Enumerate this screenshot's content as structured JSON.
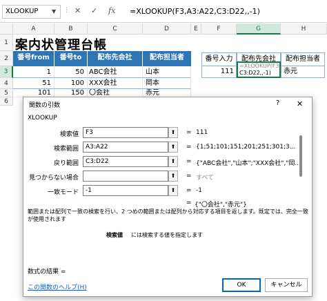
{
  "formula_bar": {
    "name_box": "XLOOKUP",
    "cancel_icon": "✕",
    "enter_icon": "✓",
    "fx_icon": "fx",
    "formula": "=XLOOKUP(F3,A3:A22,C3:D22,,-1)"
  },
  "columns": [
    "A",
    "B",
    "C",
    "D",
    "E",
    "F",
    "G",
    "H"
  ],
  "rows": [
    "1",
    "2",
    "3",
    "4",
    "5",
    "6"
  ],
  "sheet": {
    "title": "案内状管理台帳",
    "headers": [
      "番号from",
      "番号to",
      "配布先会社",
      "配布担当者"
    ],
    "data": [
      [
        "1",
        "50",
        "ABC会社",
        "山本"
      ],
      [
        "51",
        "100",
        "XXX会社",
        "岡本"
      ],
      [
        "101",
        "150",
        "〇会社",
        "赤元"
      ]
    ],
    "lookup_headers": [
      "番号入力",
      "配布先会社",
      "配布担当者"
    ],
    "lookup_input": "111",
    "editing_formula": "C3:D22,,-1)",
    "editing_formula_top": "=XLOOKUP(F3,A3:A22,",
    "lookup_result": "赤元"
  },
  "dialog": {
    "title": "関数の引数",
    "help_icon": "?",
    "close_icon": "✕",
    "function_name": "XLOOKUP",
    "args": [
      {
        "label": "検索値",
        "value": "F3",
        "result": "111"
      },
      {
        "label": "検索範囲",
        "value": "A3:A22",
        "result": "{1;51;101;151;201;251;301;3..."
      },
      {
        "label": "戻り範囲",
        "value": "C3:D22",
        "result": "{\"ABC会社\",\"山本\";\"XXX会社\",\"岡..."
      },
      {
        "label": "見つからない場合",
        "value": "",
        "result": "すべて"
      },
      {
        "label": "一致モード",
        "value": "-1",
        "result": "-1"
      }
    ],
    "overall_result": "{\"〇会社\",\"赤元\"}",
    "description": "範囲または配列で一致の検索を行い、2 つめの範囲または配列から対応する項目を返します。既定では、完全一致が使用されます",
    "arg_help_name": "検索値",
    "arg_help_text": "には検索する値を指定します",
    "formula_result_label": "数式の結果 =",
    "help_link": "この関数のヘルプ(H)",
    "ok_label": "OK",
    "cancel_label": "キャンセル"
  }
}
